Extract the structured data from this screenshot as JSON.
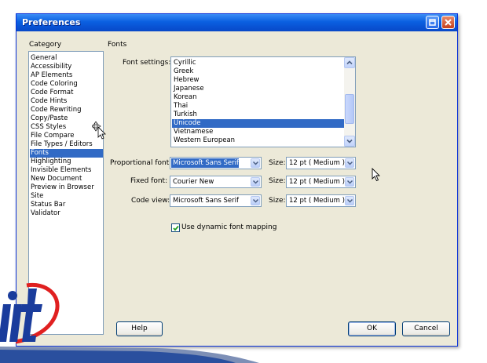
{
  "window": {
    "title": "Preferences"
  },
  "category": {
    "label": "Category",
    "items": [
      "General",
      "Accessibility",
      "AP Elements",
      "Code Coloring",
      "Code Format",
      "Code Hints",
      "Code Rewriting",
      "Copy/Paste",
      "CSS Styles",
      "File Compare",
      "File Types / Editors",
      "Fonts",
      "Highlighting",
      "Invisible Elements",
      "New Document",
      "Preview in Browser",
      "Site",
      "Status Bar",
      "Validator"
    ],
    "selected": "Fonts"
  },
  "panel": {
    "title": "Fonts"
  },
  "font_settings": {
    "label": "Font settings:",
    "items": [
      "Cyrillic",
      "Greek",
      "Hebrew",
      "Japanese",
      "Korean",
      "Thai",
      "Turkish",
      "Unicode",
      "Vietnamese",
      "Western European"
    ],
    "selected": "Unicode"
  },
  "proportional": {
    "label": "Proportional font:",
    "value": "Microsoft Sans Serif",
    "size_label": "Size:",
    "size": "12 pt  ( Medium )"
  },
  "fixed": {
    "label": "Fixed font:",
    "value": "Courier New",
    "size_label": "Size:",
    "size": "12 pt  ( Medium )"
  },
  "code_view": {
    "label": "Code view:",
    "value": "Microsoft Sans Serif",
    "size_label": "Size:",
    "size": "12 pt  ( Medium )"
  },
  "dynamic_mapping": {
    "label": "Use dynamic font mapping",
    "checked": true
  },
  "buttons": {
    "help": "Help",
    "ok": "OK",
    "cancel": "Cancel"
  },
  "colors": {
    "selection": "#316ac5",
    "titlebar": "#0a5fe0",
    "dialog_bg": "#ece9d8",
    "logo_blue": "#1a3c9c",
    "logo_red": "#e02020"
  },
  "icons": [
    "help-icon",
    "close-icon",
    "chevron-up-icon",
    "chevron-down-icon",
    "check-icon",
    "move-cursor-icon",
    "arrow-cursor-icon"
  ]
}
